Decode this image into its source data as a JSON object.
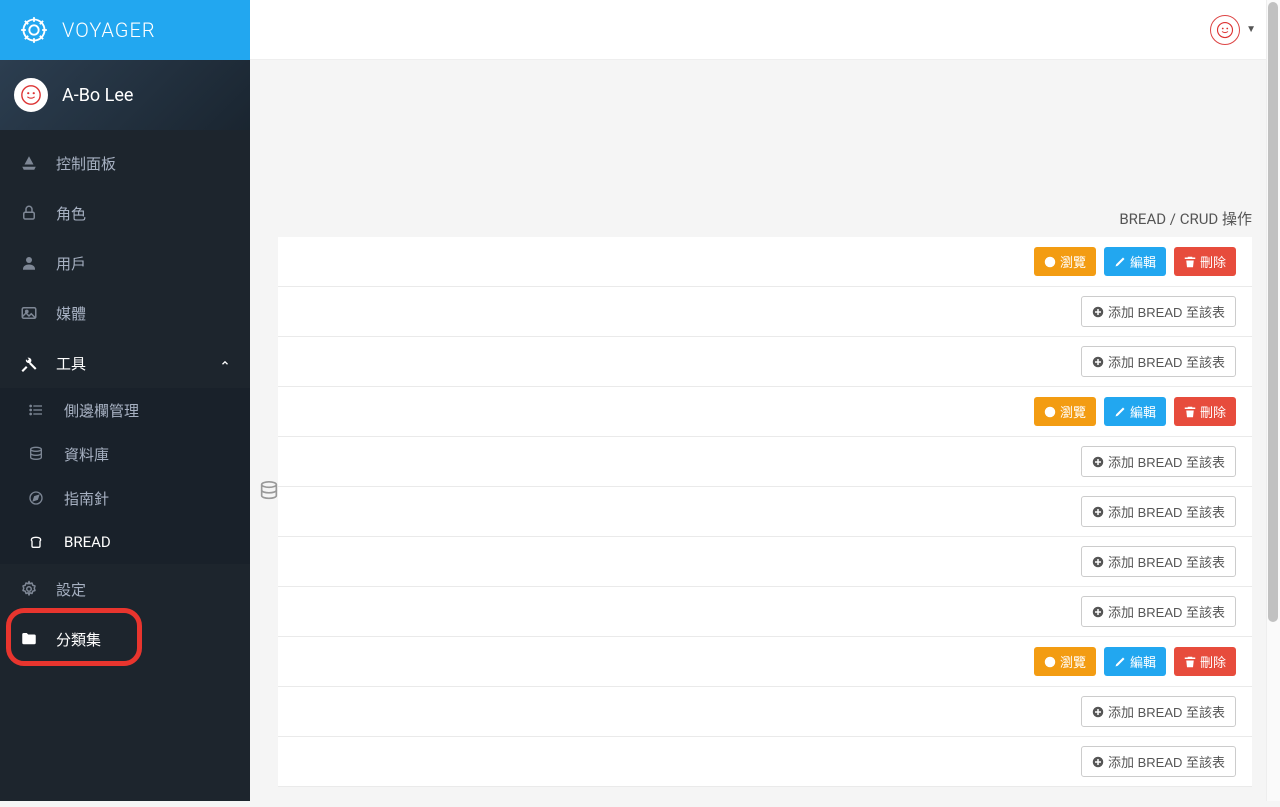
{
  "brand": "VOYAGER",
  "user": {
    "name": "A-Bo Lee"
  },
  "nav": {
    "dashboard": "控制面板",
    "roles": "角色",
    "users": "用戶",
    "media": "媒體",
    "tools": "工具",
    "menubuilder": "側邊欄管理",
    "database": "資料庫",
    "compass": "指南針",
    "bread": "BREAD",
    "settings": "設定",
    "category": "分類集"
  },
  "table": {
    "header": "BREAD / CRUD 操作",
    "buttons": {
      "browse": "瀏覽",
      "edit": "編輯",
      "delete": "刪除",
      "add": "添加 BREAD 至該表"
    }
  },
  "rows": [
    {
      "type": "bread"
    },
    {
      "type": "add"
    },
    {
      "type": "add"
    },
    {
      "type": "bread"
    },
    {
      "type": "add"
    },
    {
      "type": "add"
    },
    {
      "type": "add"
    },
    {
      "type": "add"
    },
    {
      "type": "bread"
    },
    {
      "type": "add"
    },
    {
      "type": "add"
    }
  ]
}
